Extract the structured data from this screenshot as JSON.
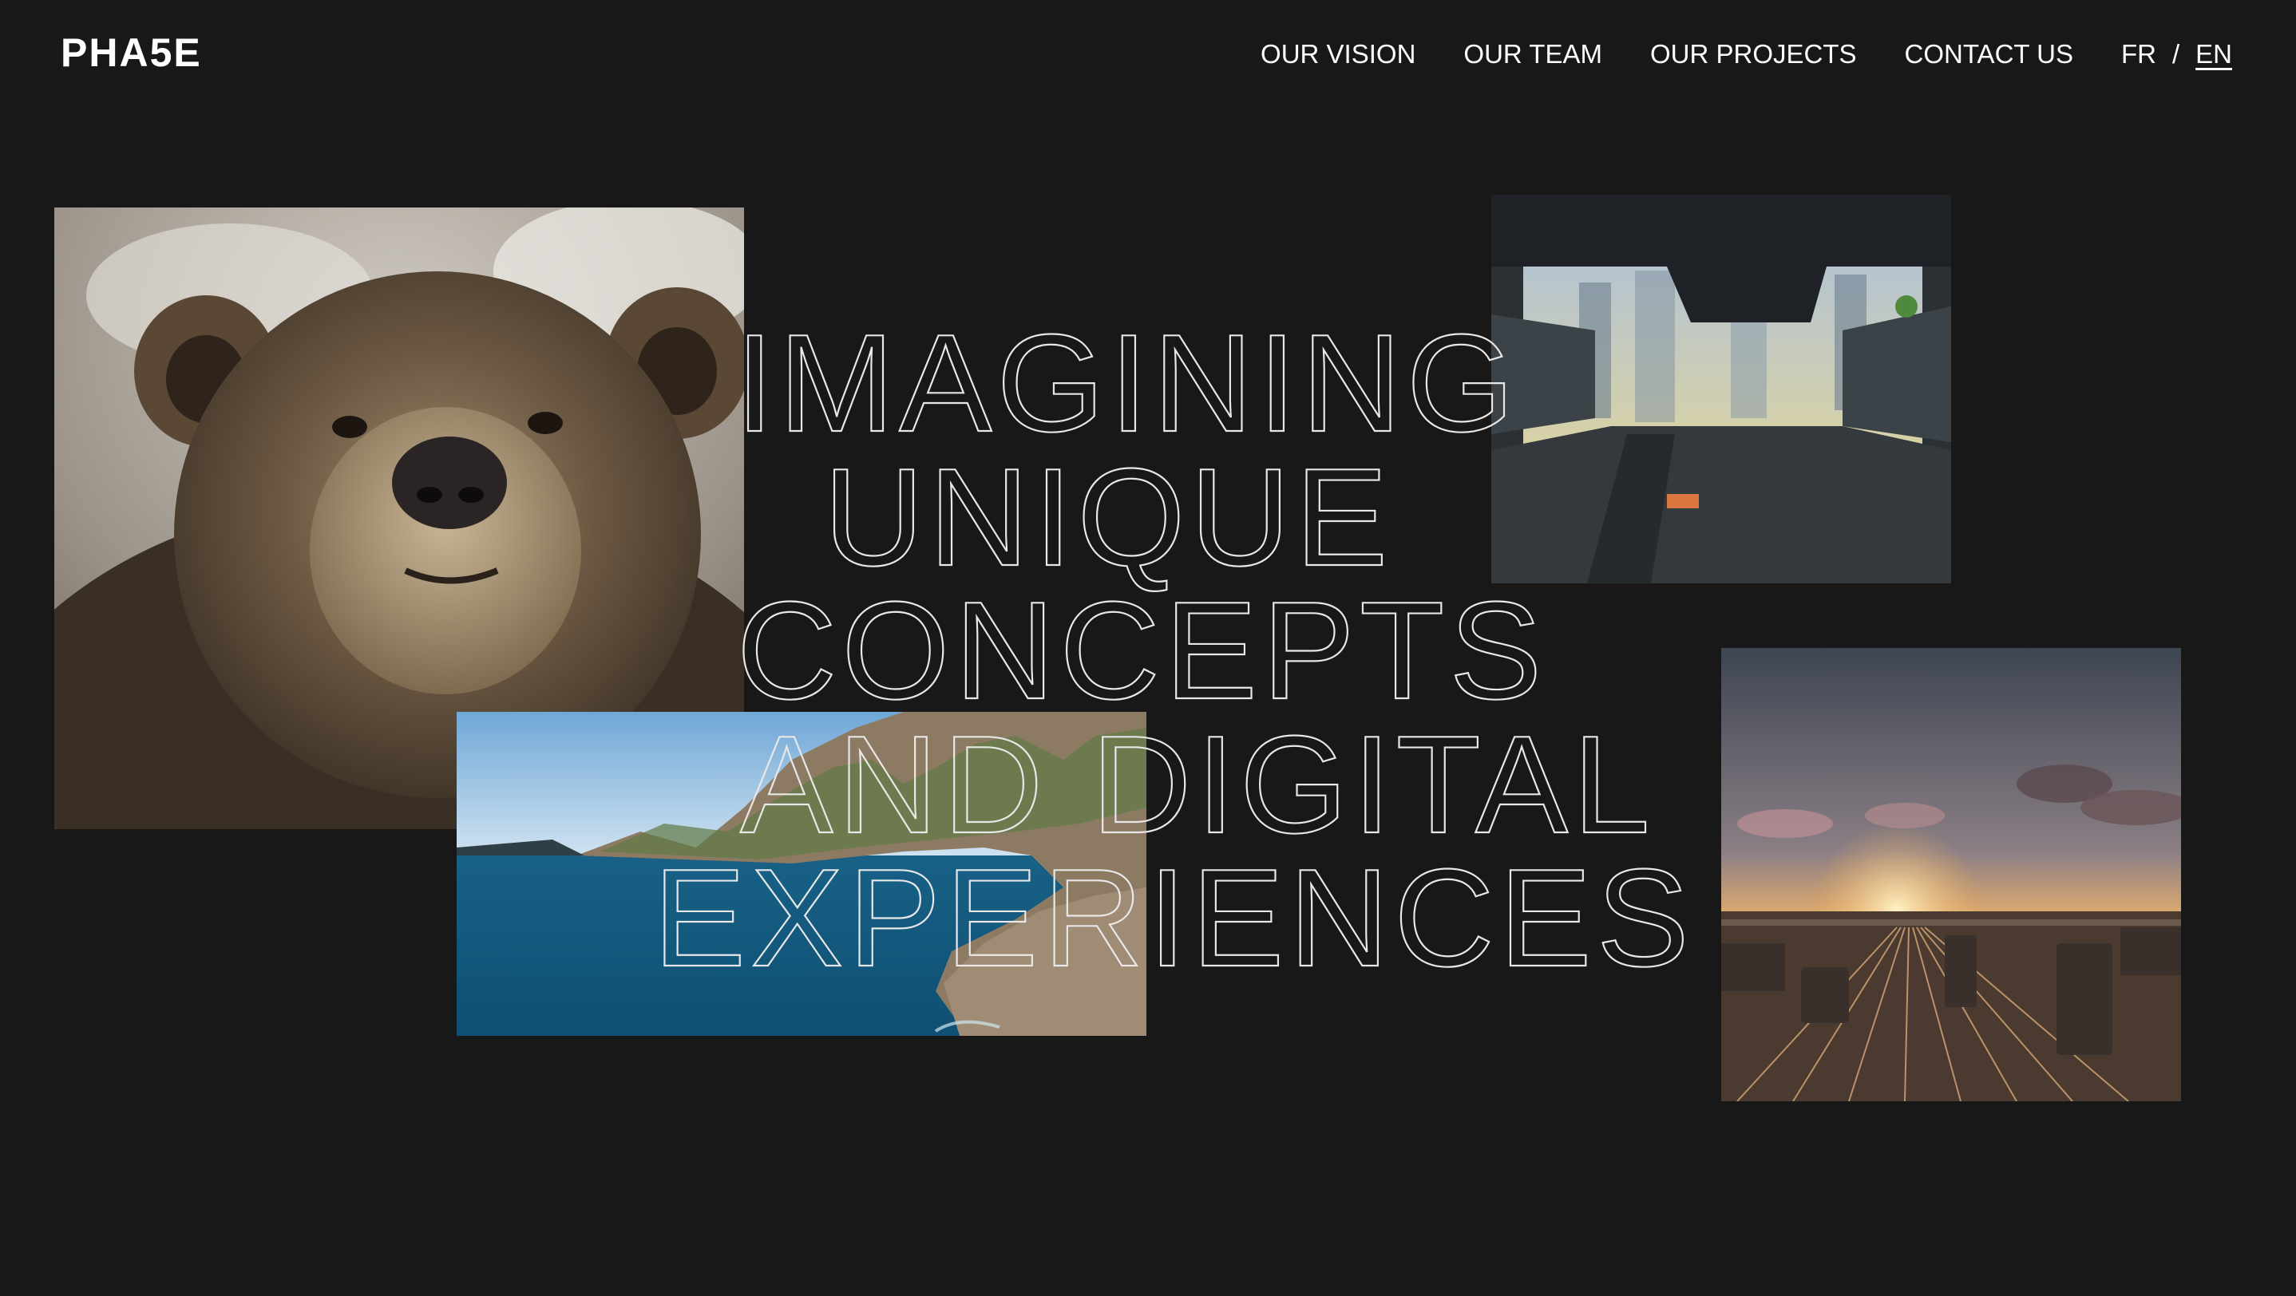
{
  "brand": {
    "logo": "PHA5E"
  },
  "nav": {
    "items": [
      {
        "label": "OUR VISION"
      },
      {
        "label": "OUR TEAM"
      },
      {
        "label": "OUR PROJECTS"
      },
      {
        "label": "CONTACT US"
      }
    ],
    "language": {
      "fr": "FR",
      "separator": "/",
      "en": "EN",
      "active": "EN"
    }
  },
  "hero": {
    "headline_lines": [
      "IMAGINING",
      "UNIQUE",
      "CONCEPTS",
      "AND DIGITAL",
      "EXPERIENCES"
    ]
  },
  "colors": {
    "background": "#181818",
    "text": "#ffffff",
    "outline": "#e8e8e8"
  }
}
